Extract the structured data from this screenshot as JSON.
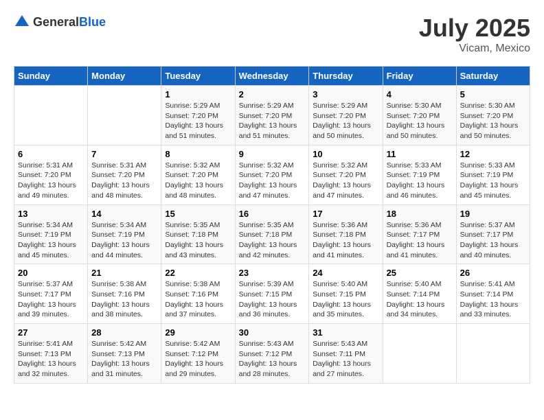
{
  "header": {
    "logo_general": "General",
    "logo_blue": "Blue",
    "month_year": "July 2025",
    "location": "Vicam, Mexico"
  },
  "days_of_week": [
    "Sunday",
    "Monday",
    "Tuesday",
    "Wednesday",
    "Thursday",
    "Friday",
    "Saturday"
  ],
  "weeks": [
    [
      {
        "day": "",
        "detail": ""
      },
      {
        "day": "",
        "detail": ""
      },
      {
        "day": "1",
        "detail": "Sunrise: 5:29 AM\nSunset: 7:20 PM\nDaylight: 13 hours and 51 minutes."
      },
      {
        "day": "2",
        "detail": "Sunrise: 5:29 AM\nSunset: 7:20 PM\nDaylight: 13 hours and 51 minutes."
      },
      {
        "day": "3",
        "detail": "Sunrise: 5:29 AM\nSunset: 7:20 PM\nDaylight: 13 hours and 50 minutes."
      },
      {
        "day": "4",
        "detail": "Sunrise: 5:30 AM\nSunset: 7:20 PM\nDaylight: 13 hours and 50 minutes."
      },
      {
        "day": "5",
        "detail": "Sunrise: 5:30 AM\nSunset: 7:20 PM\nDaylight: 13 hours and 50 minutes."
      }
    ],
    [
      {
        "day": "6",
        "detail": "Sunrise: 5:31 AM\nSunset: 7:20 PM\nDaylight: 13 hours and 49 minutes."
      },
      {
        "day": "7",
        "detail": "Sunrise: 5:31 AM\nSunset: 7:20 PM\nDaylight: 13 hours and 48 minutes."
      },
      {
        "day": "8",
        "detail": "Sunrise: 5:32 AM\nSunset: 7:20 PM\nDaylight: 13 hours and 48 minutes."
      },
      {
        "day": "9",
        "detail": "Sunrise: 5:32 AM\nSunset: 7:20 PM\nDaylight: 13 hours and 47 minutes."
      },
      {
        "day": "10",
        "detail": "Sunrise: 5:32 AM\nSunset: 7:20 PM\nDaylight: 13 hours and 47 minutes."
      },
      {
        "day": "11",
        "detail": "Sunrise: 5:33 AM\nSunset: 7:19 PM\nDaylight: 13 hours and 46 minutes."
      },
      {
        "day": "12",
        "detail": "Sunrise: 5:33 AM\nSunset: 7:19 PM\nDaylight: 13 hours and 45 minutes."
      }
    ],
    [
      {
        "day": "13",
        "detail": "Sunrise: 5:34 AM\nSunset: 7:19 PM\nDaylight: 13 hours and 45 minutes."
      },
      {
        "day": "14",
        "detail": "Sunrise: 5:34 AM\nSunset: 7:19 PM\nDaylight: 13 hours and 44 minutes."
      },
      {
        "day": "15",
        "detail": "Sunrise: 5:35 AM\nSunset: 7:18 PM\nDaylight: 13 hours and 43 minutes."
      },
      {
        "day": "16",
        "detail": "Sunrise: 5:35 AM\nSunset: 7:18 PM\nDaylight: 13 hours and 42 minutes."
      },
      {
        "day": "17",
        "detail": "Sunrise: 5:36 AM\nSunset: 7:18 PM\nDaylight: 13 hours and 41 minutes."
      },
      {
        "day": "18",
        "detail": "Sunrise: 5:36 AM\nSunset: 7:17 PM\nDaylight: 13 hours and 41 minutes."
      },
      {
        "day": "19",
        "detail": "Sunrise: 5:37 AM\nSunset: 7:17 PM\nDaylight: 13 hours and 40 minutes."
      }
    ],
    [
      {
        "day": "20",
        "detail": "Sunrise: 5:37 AM\nSunset: 7:17 PM\nDaylight: 13 hours and 39 minutes."
      },
      {
        "day": "21",
        "detail": "Sunrise: 5:38 AM\nSunset: 7:16 PM\nDaylight: 13 hours and 38 minutes."
      },
      {
        "day": "22",
        "detail": "Sunrise: 5:38 AM\nSunset: 7:16 PM\nDaylight: 13 hours and 37 minutes."
      },
      {
        "day": "23",
        "detail": "Sunrise: 5:39 AM\nSunset: 7:15 PM\nDaylight: 13 hours and 36 minutes."
      },
      {
        "day": "24",
        "detail": "Sunrise: 5:40 AM\nSunset: 7:15 PM\nDaylight: 13 hours and 35 minutes."
      },
      {
        "day": "25",
        "detail": "Sunrise: 5:40 AM\nSunset: 7:14 PM\nDaylight: 13 hours and 34 minutes."
      },
      {
        "day": "26",
        "detail": "Sunrise: 5:41 AM\nSunset: 7:14 PM\nDaylight: 13 hours and 33 minutes."
      }
    ],
    [
      {
        "day": "27",
        "detail": "Sunrise: 5:41 AM\nSunset: 7:13 PM\nDaylight: 13 hours and 32 minutes."
      },
      {
        "day": "28",
        "detail": "Sunrise: 5:42 AM\nSunset: 7:13 PM\nDaylight: 13 hours and 31 minutes."
      },
      {
        "day": "29",
        "detail": "Sunrise: 5:42 AM\nSunset: 7:12 PM\nDaylight: 13 hours and 29 minutes."
      },
      {
        "day": "30",
        "detail": "Sunrise: 5:43 AM\nSunset: 7:12 PM\nDaylight: 13 hours and 28 minutes."
      },
      {
        "day": "31",
        "detail": "Sunrise: 5:43 AM\nSunset: 7:11 PM\nDaylight: 13 hours and 27 minutes."
      },
      {
        "day": "",
        "detail": ""
      },
      {
        "day": "",
        "detail": ""
      }
    ]
  ]
}
